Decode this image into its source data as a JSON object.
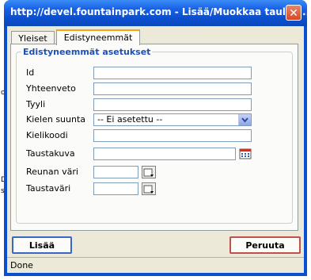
{
  "window": {
    "title": "http://devel.fountainpark.com - Lisää/Muokkaa tauluk..."
  },
  "tabs": [
    {
      "label": "Yleiset"
    },
    {
      "label": "Edistyneemmät"
    }
  ],
  "fieldset": {
    "legend": "Edistyneemmät asetukset"
  },
  "fields": {
    "id": {
      "label": "Id",
      "value": ""
    },
    "summary": {
      "label": "Yhteenveto",
      "value": ""
    },
    "style": {
      "label": "Tyyli",
      "value": ""
    },
    "direction": {
      "label": "Kielen suunta",
      "value": "-- Ei asetettu --"
    },
    "langcode": {
      "label": "Kielikoodi",
      "value": ""
    },
    "background_image": {
      "label": "Taustakuva",
      "value": ""
    },
    "border_color": {
      "label": "Reunan väri",
      "value": ""
    },
    "background_color": {
      "label": "Taustaväri",
      "value": ""
    }
  },
  "buttons": {
    "insert": "Lisää",
    "cancel": "Peruuta"
  },
  "status": {
    "text": "Done"
  },
  "colors": {
    "title_blue": "#0a4fd0",
    "dialog_bg": "#ece9d8",
    "legend": "#1e4fb4",
    "tab_accent": "#f4a41c",
    "insert_border": "#3a66c6",
    "cancel_border": "#c0504d"
  }
}
